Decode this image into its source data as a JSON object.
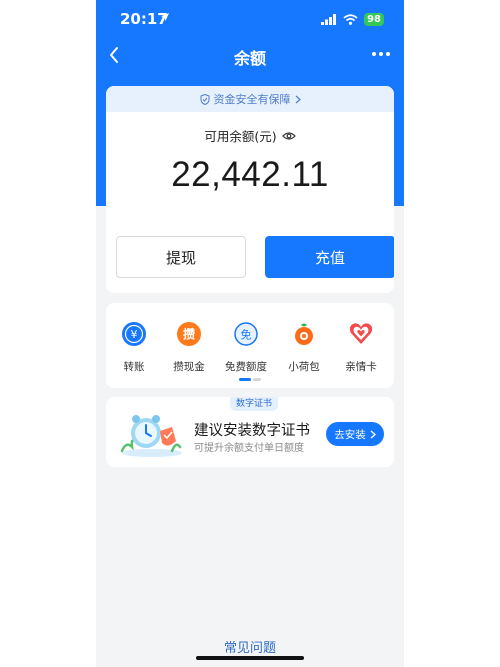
{
  "status_bar": {
    "time": "20:17",
    "battery": "98"
  },
  "nav": {
    "title": "余额"
  },
  "safety_banner": "资金安全有保障",
  "balance": {
    "label": "可用余额(元)",
    "amount": "22,442.11"
  },
  "actions": {
    "withdraw": "提现",
    "recharge": "充值"
  },
  "services": [
    {
      "label": "转账",
      "icon": "transfer-icon",
      "color": "#1677ff"
    },
    {
      "label": "攒现金",
      "icon": "save-cash-icon",
      "color": "#ff7a1a"
    },
    {
      "label": "免费额度",
      "icon": "free-quota-icon",
      "color": "#1677ff"
    },
    {
      "label": "小荷包",
      "icon": "small-wallet-icon",
      "color": "#ff6a1a"
    },
    {
      "label": "亲情卡",
      "icon": "family-card-icon",
      "color": "#f24b4b"
    }
  ],
  "cert_promo": {
    "tag": "数字证书",
    "title": "建议安装数字证书",
    "subtitle": "可提升余额支付单日额度",
    "button": "去安装"
  },
  "faq": "常见问题",
  "colors": {
    "primary": "#1677ff",
    "background": "#f3f4f6"
  }
}
